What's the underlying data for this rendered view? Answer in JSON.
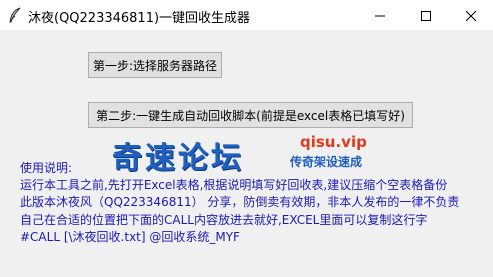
{
  "window": {
    "title": "沐夜(QQ223346811)一键回收生成器",
    "controls": {
      "minimize_icon": "minimize-icon",
      "maximize_icon": "maximize-icon",
      "close_icon": "close-icon"
    }
  },
  "buttons": {
    "step1_label": "第一步:选择服务器路径",
    "step2_label": "第二步:一键生成自动回收脚本(前提是excel表格已填写好)"
  },
  "watermark": {
    "big_text": "奇速论坛",
    "domain": "qisu.vip",
    "tagline": "传奇架设速成"
  },
  "instructions": {
    "lines": [
      "使用说明:",
      "运行本工具之前,先打开Excel表格,根据说明填写好回收表,建议压缩个空表格备份",
      "此版本沐夜风（QQ223346811） 分享，防倒卖有效期，非本人发布的一律不负责",
      "自己在合适的位置把下面的CALL内容放进去就好,EXCEL里面可以复制这行字",
      "#CALL [\\沐夜回收.txt] @回收系统_MYF"
    ]
  },
  "colors": {
    "titlebar_bg": "#ffffff",
    "window_bg": "#f0f0f0",
    "instruction_text": "#1a1ab8",
    "watermark_blue": "#1f5fbf",
    "watermark_red": "#e23a1e"
  }
}
